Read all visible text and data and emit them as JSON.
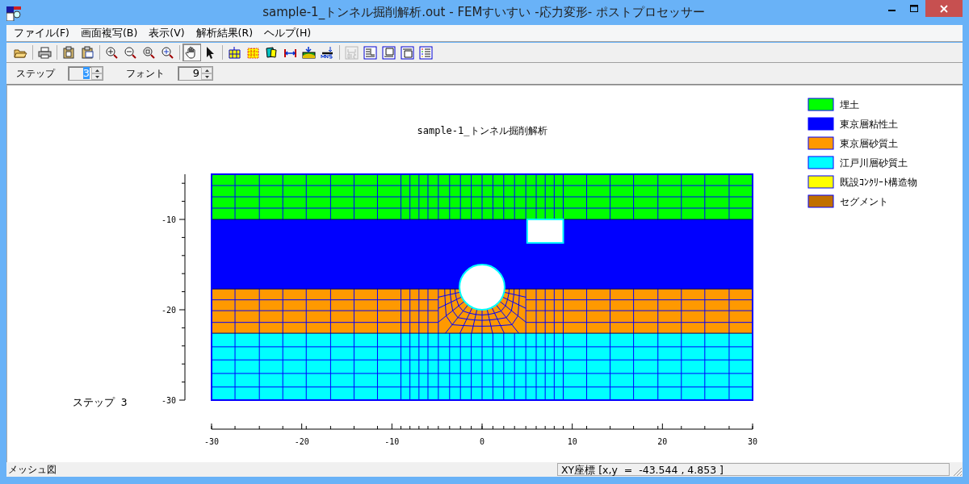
{
  "window": {
    "title": "sample-1_トンネル掘削解析.out - FEMすいすい -応力変形- ポストプロセッサー"
  },
  "menu": [
    {
      "label": "ファイル(F)"
    },
    {
      "label": "画面複写(B)"
    },
    {
      "label": "表示(V)"
    },
    {
      "label": "解析結果(R)"
    },
    {
      "label": "ヘルプ(H)"
    }
  ],
  "toolbar": [
    [
      {
        "kind": "open",
        "selected": false,
        "disabled": false
      }
    ],
    [
      {
        "kind": "print",
        "selected": false,
        "disabled": false
      }
    ],
    [
      {
        "kind": "copy",
        "selected": false,
        "disabled": false
      },
      {
        "kind": "copy-file",
        "selected": false,
        "disabled": false
      }
    ],
    [
      {
        "kind": "zoom-in",
        "selected": false,
        "disabled": false
      },
      {
        "kind": "zoom-out",
        "selected": false,
        "disabled": false
      },
      {
        "kind": "zoom-window",
        "selected": false,
        "disabled": false
      },
      {
        "kind": "zoom-all",
        "selected": false,
        "disabled": false
      }
    ],
    [
      {
        "kind": "pan",
        "selected": true,
        "disabled": false
      },
      {
        "kind": "pointer",
        "selected": false,
        "disabled": false
      }
    ],
    [
      {
        "kind": "mesh",
        "selected": false,
        "disabled": false
      },
      {
        "kind": "nodes",
        "selected": false,
        "disabled": false
      },
      {
        "kind": "material",
        "selected": false,
        "disabled": false
      },
      {
        "kind": "boundary",
        "selected": false,
        "disabled": false
      },
      {
        "kind": "load",
        "selected": false,
        "disabled": false
      },
      {
        "kind": "mns",
        "selected": false,
        "disabled": false
      }
    ],
    [
      {
        "kind": "numbers",
        "selected": false,
        "disabled": true
      },
      {
        "kind": "view-left",
        "selected": false,
        "disabled": false
      },
      {
        "kind": "view-bottom",
        "selected": false,
        "disabled": false
      },
      {
        "kind": "view-top",
        "selected": false,
        "disabled": false
      },
      {
        "kind": "view-list",
        "selected": false,
        "disabled": false
      }
    ]
  ],
  "spinners": [
    {
      "label": "ステップ",
      "value": "3",
      "focused": true
    },
    {
      "label": "フォント",
      "value": "9",
      "focused": false
    }
  ],
  "plot": {
    "title": "sample-1_トンネル掘削解析",
    "step_label": "ステップ 3",
    "x_tick_labels": [
      "-30",
      "-20",
      "-10",
      "0",
      "10",
      "20",
      "30"
    ],
    "y_tick_labels": [
      "-10",
      "-20",
      "-30"
    ]
  },
  "legend": [
    {
      "label": "埋土",
      "color": "#00ff00"
    },
    {
      "label": "東京層粘性土",
      "color": "#0000ff"
    },
    {
      "label": "東京層砂質土",
      "color": "#ff9900"
    },
    {
      "label": "江戸川層砂質土",
      "color": "#00ffff"
    },
    {
      "label": "既設ｺﾝｸﾘｰﾄ構造物",
      "color": "#ffff00"
    },
    {
      "label": "セグメント",
      "color": "#c07000"
    }
  ],
  "status_bar": {
    "left": "メッシュ図",
    "right": "XY座標 [x,y  =  -43.544 , 4.853 ]"
  }
}
